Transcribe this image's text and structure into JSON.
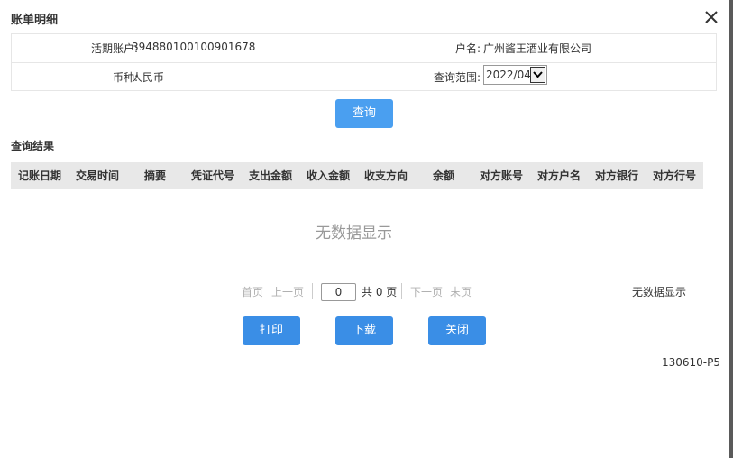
{
  "dialog": {
    "title": "账单明细",
    "close_icon": "close-icon"
  },
  "info": {
    "account_label": "活期账户:",
    "account_value": "394880100100901678",
    "name_label": "户名:",
    "name_value": "广州酱王酒业有限公司",
    "currency_label": "币种:",
    "currency_value": "人民币",
    "range_label": "查询范围:",
    "range_value": "2022/04"
  },
  "query_button": "查询",
  "results_title": "查询结果",
  "table": {
    "headers": [
      "记账日期",
      "交易时间",
      "摘要",
      "凭证代号",
      "支出金额",
      "收入金额",
      "收支方向",
      "余额",
      "对方账号",
      "对方户名",
      "对方银行",
      "对方行号"
    ],
    "empty_text": "无数据显示"
  },
  "pager": {
    "first": "首页",
    "prev": "上一页",
    "page_input": "0",
    "total": "共 0 页",
    "next": "下一页",
    "last": "末页",
    "status": "无数据显示"
  },
  "buttons": {
    "print": "打印",
    "download": "下载",
    "close": "关闭"
  },
  "footer_code": "130610-P5",
  "colors": {
    "primary": "#3a8ee6",
    "header_bg": "#e8e8e8"
  }
}
